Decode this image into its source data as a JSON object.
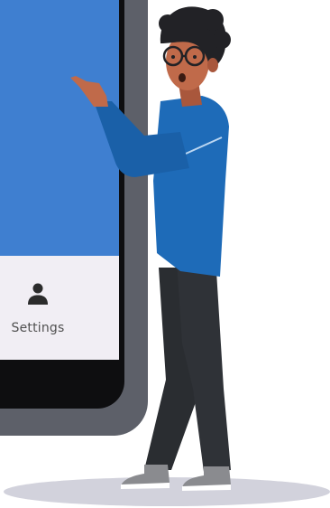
{
  "colors": {
    "screen_blue": "#3f7fd0",
    "bottom_bar": "#f1eef4",
    "shirt_blue": "#1e6bb8",
    "pants": "#2f3237",
    "skin": "#c06a4a",
    "hair": "#222226",
    "shoe": "#8a8b8f"
  },
  "bottom_nav": {
    "items": [
      {
        "label": "Settings",
        "icon": "person-icon"
      }
    ]
  }
}
